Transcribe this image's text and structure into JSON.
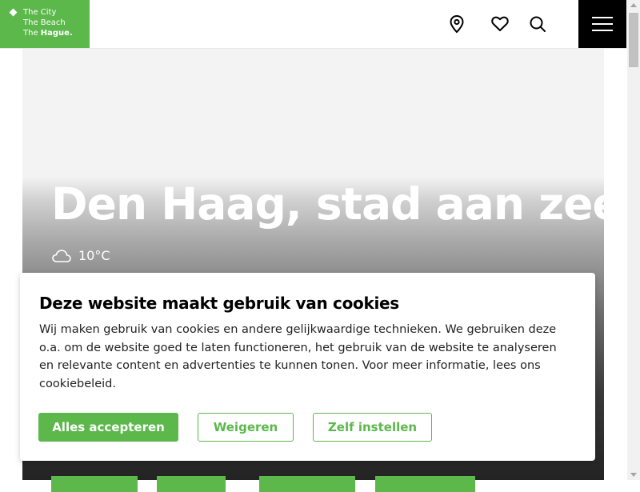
{
  "header": {
    "logo": {
      "line1": "The City",
      "line2": "The Beach",
      "line3_prefix": "The ",
      "line3_bold": "Hague."
    },
    "icons": [
      "location-pin-icon",
      "heart-icon",
      "search-icon",
      "menu-icon"
    ]
  },
  "hero": {
    "title": "Den Haag, stad aan zee",
    "weather": {
      "icon": "cloud-icon",
      "temperature": "10°C"
    }
  },
  "cookie_dialog": {
    "title": "Deze website maakt gebruik van cookies",
    "body": "Wij maken gebruik van cookies en andere gelijkwaardige technieken. We gebruiken deze o.a. om de website goed te laten functioneren, het gebruik van de website te analyseren en relevante content en advertenties te kunnen tonen. Voor meer informatie, lees ons cookiebeleid.",
    "buttons": {
      "accept": "Alles accepteren",
      "reject": "Weigeren",
      "settings": "Zelf instellen"
    }
  },
  "colors": {
    "brand_green": "#5cb84b",
    "menu_black": "#000000"
  }
}
